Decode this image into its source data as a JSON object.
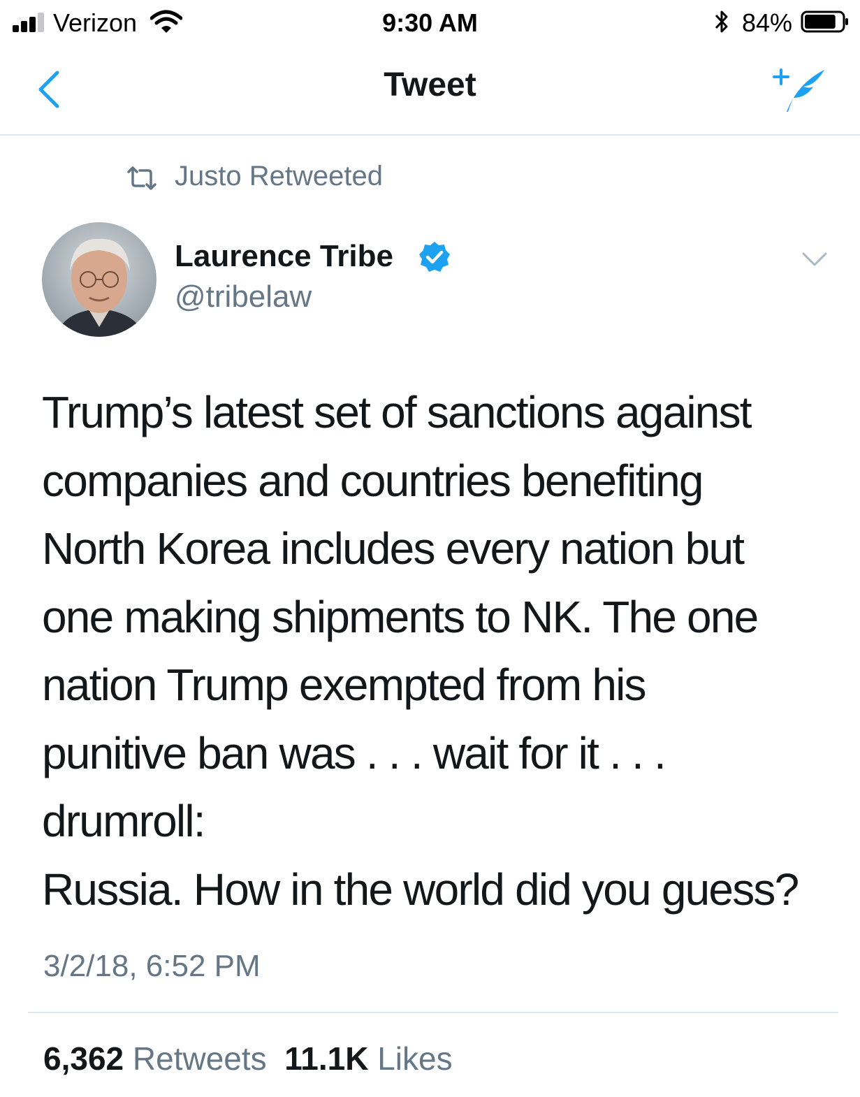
{
  "status_bar": {
    "carrier": "Verizon",
    "time": "9:30 AM",
    "battery_percent": "84%",
    "battery_level": 0.84,
    "signal_bars": 3,
    "signal_bars_total": 4,
    "icons": [
      "signal-icon",
      "wifi-icon",
      "bluetooth-icon",
      "battery-icon"
    ]
  },
  "nav": {
    "title": "Tweet",
    "back_icon": "chevron-left-icon",
    "compose_icon": "compose-tweet-icon"
  },
  "retweet": {
    "text": "Justo Retweeted",
    "icon": "retweet-icon"
  },
  "tweet": {
    "author_name": "Laurence Tribe",
    "handle": "@tribelaw",
    "verified": true,
    "body_lines": [
      "Trump’s latest set of sanctions against",
      "companies and countries benefiting",
      "North Korea includes every nation but",
      "one making shipments to NK. The one",
      "nation Trump exempted from his",
      "punitive ban was . . . wait for it . . .",
      "drumroll:",
      "Russia. How in the world did you guess?"
    ],
    "timestamp": "3/2/18, 6:52 PM",
    "retweets_count": "6,362",
    "retweets_label": "Retweets",
    "likes_count": "11.1K",
    "likes_label": "Likes"
  },
  "colors": {
    "accent": "#1da1f2",
    "text_primary": "#14171a",
    "text_secondary": "#657786",
    "divider": "#e1e8ed"
  }
}
